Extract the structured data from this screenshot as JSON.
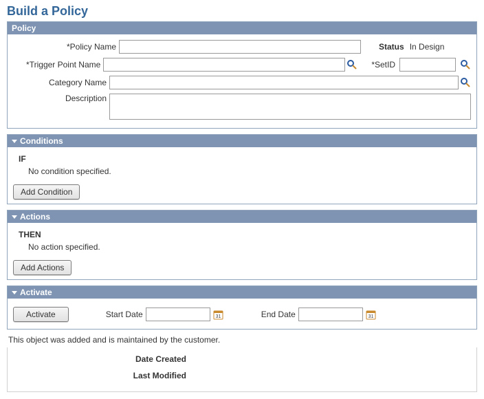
{
  "page_title": "Build a Policy",
  "sections": {
    "policy": {
      "header": "Policy",
      "policy_name_label": "*Policy Name",
      "status_label": "Status",
      "status_value": "In Design",
      "trigger_point_label": "*Trigger Point Name",
      "setid_label": "*SetID",
      "category_label": "Category Name",
      "description_label": "Description"
    },
    "conditions": {
      "header": "Conditions",
      "if_label": "IF",
      "empty_msg": "No condition specified.",
      "add_button": "Add Condition"
    },
    "actions": {
      "header": "Actions",
      "then_label": "THEN",
      "empty_msg": "No action specified.",
      "add_button": "Add Actions"
    },
    "activate": {
      "header": "Activate",
      "activate_button": "Activate",
      "start_date_label": "Start Date",
      "end_date_label": "End Date"
    }
  },
  "footnote": "This object was added and is maintained by the customer.",
  "meta": {
    "date_created_label": "Date Created",
    "last_modified_label": "Last Modified"
  }
}
